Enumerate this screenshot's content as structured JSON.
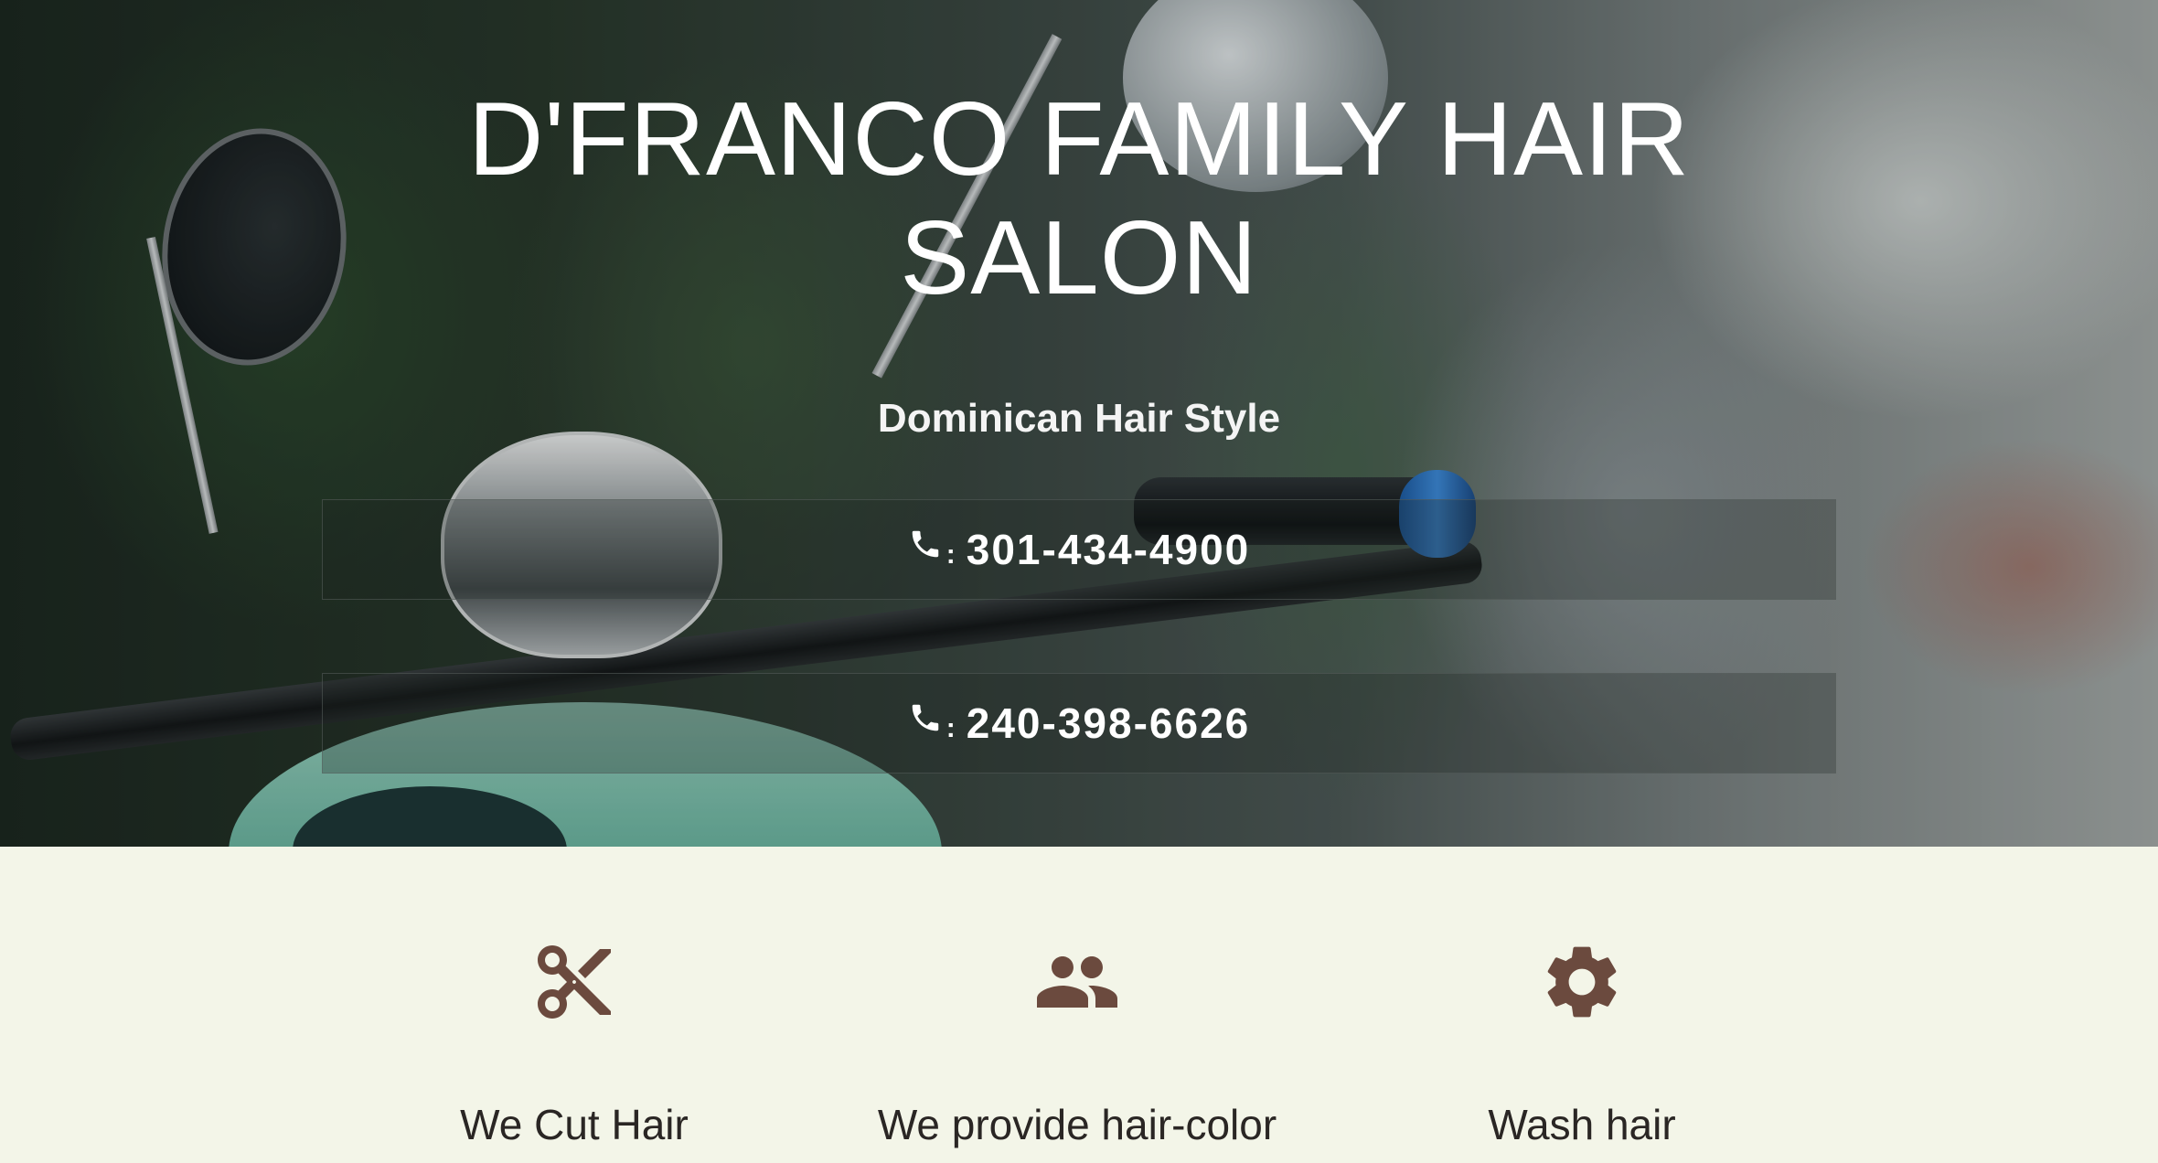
{
  "hero": {
    "title": "D'FRANCO FAMILY HAIR SALON",
    "subtitle": "Dominican Hair Style",
    "phones": [
      {
        "icon": "phone-icon",
        "separator": ":",
        "number": "301-434-4900"
      },
      {
        "icon": "phone-icon",
        "separator": ":",
        "number": "240-398-6626"
      }
    ]
  },
  "features": [
    {
      "icon": "scissors-icon",
      "label": "We Cut Hair"
    },
    {
      "icon": "people-icon",
      "label": "We provide hair-color"
    },
    {
      "icon": "gear-icon",
      "label": "Wash hair"
    }
  ],
  "colors": {
    "feature_background": "#f3f5e8",
    "icon_brown": "#6b4a3e",
    "hero_text": "#ffffff",
    "feature_text": "#2a2624"
  }
}
